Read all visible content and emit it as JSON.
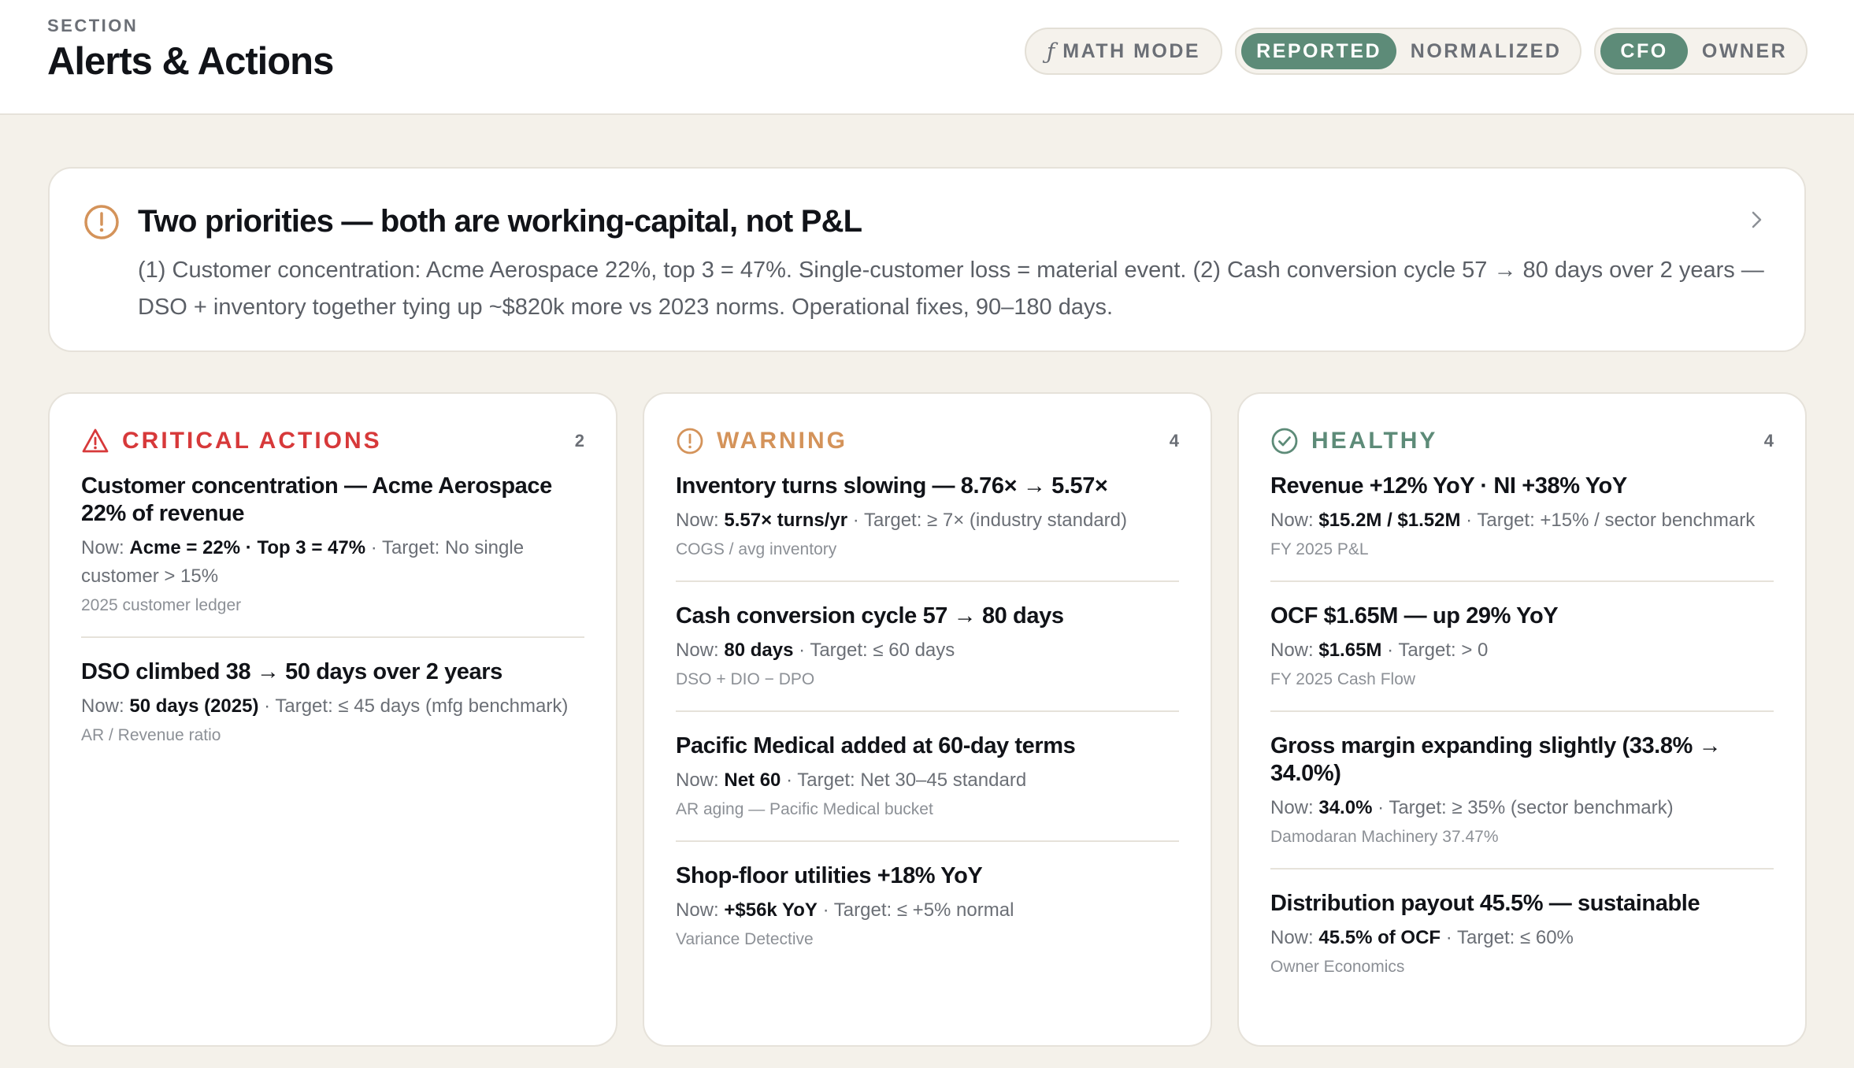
{
  "header": {
    "section_label": "SECTION",
    "title": "Alerts & Actions",
    "math_mode_label": "MATH MODE",
    "math_mode_icon": "function-icon",
    "view_toggle": [
      "REPORTED",
      "NORMALIZED"
    ],
    "view_selected": "REPORTED",
    "role_toggle": [
      "CFO",
      "OWNER"
    ],
    "role_selected": "CFO"
  },
  "priority": {
    "icon": "alert-circle-icon",
    "title": "Two priorities — both are working-capital, not P&L",
    "body": "(1) Customer concentration: Acme Aerospace 22%, top 3 = 47%. Single-customer loss = material event. (2) Cash conversion cycle 57 → 80 days over 2 years — DSO + inventory together tying up ~$820k more vs 2023 norms. Operational fixes, 90–180 days."
  },
  "colors": {
    "critical": "#d7393a",
    "warning": "#d4935a",
    "healthy": "#5d8b78",
    "background": "#f4f1ea"
  },
  "columns": [
    {
      "title": "CRITICAL ACTIONS",
      "count": "2",
      "icon": "warning-triangle-icon",
      "items": [
        {
          "title": "Customer concentration — Acme Aerospace 22% of revenue",
          "now_label": "Now:",
          "now_value": "Acme = 22% · Top 3 = 47%",
          "target": "· Target: No single customer > 15%",
          "source": "2025 customer ledger"
        },
        {
          "title": "DSO climbed 38 → 50 days over 2 years",
          "now_label": "Now:",
          "now_value": "50 days (2025)",
          "target": "· Target: ≤ 45 days (mfg benchmark)",
          "source": "AR / Revenue ratio"
        }
      ]
    },
    {
      "title": "WARNING",
      "count": "4",
      "icon": "alert-circle-icon",
      "items": [
        {
          "title": "Inventory turns slowing — 8.76× → 5.57×",
          "now_label": "Now:",
          "now_value": "5.57× turns/yr",
          "target": "· Target: ≥ 7× (industry standard)",
          "source": "COGS / avg inventory"
        },
        {
          "title": "Cash conversion cycle 57 → 80 days",
          "now_label": "Now:",
          "now_value": "80 days",
          "target": "· Target: ≤ 60 days",
          "source": "DSO + DIO − DPO"
        },
        {
          "title": "Pacific Medical added at 60-day terms",
          "now_label": "Now:",
          "now_value": "Net 60",
          "target": "· Target: Net 30–45 standard",
          "source": "AR aging — Pacific Medical bucket"
        },
        {
          "title": "Shop-floor utilities +18% YoY",
          "now_label": "Now:",
          "now_value": "+$56k YoY",
          "target": "· Target: ≤ +5% normal",
          "source": "Variance Detective"
        }
      ]
    },
    {
      "title": "HEALTHY",
      "count": "4",
      "icon": "check-circle-icon",
      "items": [
        {
          "title": "Revenue +12% YoY · NI +38% YoY",
          "now_label": "Now:",
          "now_value": "$15.2M / $1.52M",
          "target": "· Target: +15% / sector benchmark",
          "source": "FY 2025 P&L"
        },
        {
          "title": "OCF $1.65M — up 29% YoY",
          "now_label": "Now:",
          "now_value": "$1.65M",
          "target": "· Target: > 0",
          "source": "FY 2025 Cash Flow"
        },
        {
          "title": "Gross margin expanding slightly (33.8% → 34.0%)",
          "now_label": "Now:",
          "now_value": "34.0%",
          "target": "· Target: ≥ 35% (sector benchmark)",
          "source": "Damodaran Machinery 37.47%"
        },
        {
          "title": "Distribution payout 45.5% — sustainable",
          "now_label": "Now:",
          "now_value": "45.5% of OCF",
          "target": "· Target: ≤ 60%",
          "source": "Owner Economics"
        }
      ]
    }
  ]
}
